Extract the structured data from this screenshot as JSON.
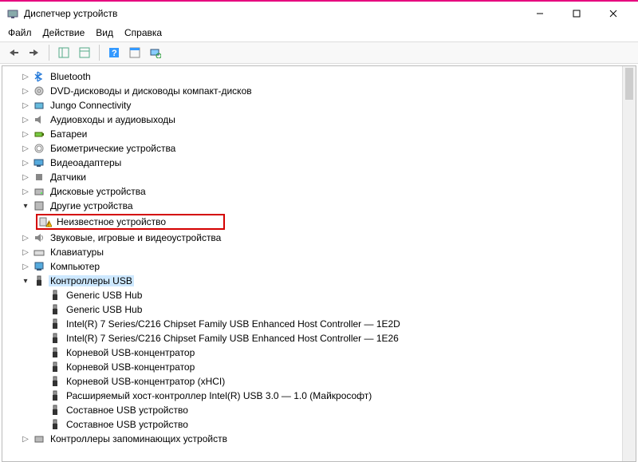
{
  "window": {
    "title": "Диспетчер устройств"
  },
  "menu": {
    "file": "Файл",
    "action": "Действие",
    "view": "Вид",
    "help": "Справка"
  },
  "tree": {
    "bluetooth": "Bluetooth",
    "dvd": "DVD-дисководы и дисководы компакт-дисков",
    "jungo": "Jungo Connectivity",
    "audio_io": "Аудиовходы и аудиовыходы",
    "batteries": "Батареи",
    "biometric": "Биометрические устройства",
    "video_adapters": "Видеоадаптеры",
    "sensors": "Датчики",
    "disk_devices": "Дисковые устройства",
    "other_devices": "Другие устройства",
    "unknown_device": "Неизвестное устройство",
    "sound_video_game": "Звуковые, игровые и видеоустройства",
    "keyboards": "Клавиатуры",
    "computer": "Компьютер",
    "usb_controllers": "Контроллеры USB",
    "generic_usb_hub_1": "Generic USB Hub",
    "generic_usb_hub_2": "Generic USB Hub",
    "intel_1e2d": "Intel(R) 7 Series/C216 Chipset Family USB Enhanced Host Controller — 1E2D",
    "intel_1e26": "Intel(R) 7 Series/C216 Chipset Family USB Enhanced Host Controller — 1E26",
    "root_hub_1": "Корневой USB-концентратор",
    "root_hub_2": "Корневой USB-концентратор",
    "root_hub_xhci": "Корневой USB-концентратор (xHCI)",
    "extensible_xhci": "Расширяемый хост-контроллер Intel(R) USB 3.0 — 1.0 (Майкрософт)",
    "composite_1": "Составное USB устройство",
    "composite_2": "Составное USB устройство",
    "storage_controllers": "Контроллеры запоминающих устройств"
  }
}
